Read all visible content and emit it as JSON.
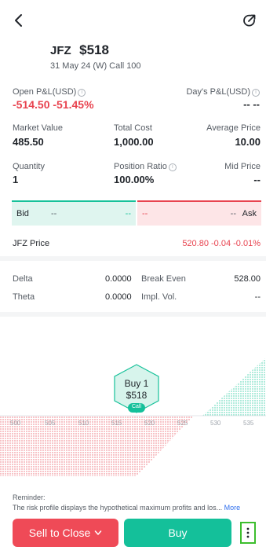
{
  "header": {
    "symbol": "JFZ",
    "price": "$518",
    "contract": "31 May 24 (W) Call 100"
  },
  "pl": {
    "open_label": "Open P&L(USD)",
    "open_value": "-514.50 -51.45%",
    "day_label": "Day's P&L(USD)",
    "day_value": "-- --"
  },
  "stats": {
    "market_value_label": "Market Value",
    "market_value": "485.50",
    "total_cost_label": "Total Cost",
    "total_cost": "1,000.00",
    "avg_price_label": "Average Price",
    "avg_price": "10.00",
    "quantity_label": "Quantity",
    "quantity": "1",
    "position_ratio_label": "Position Ratio",
    "position_ratio": "100.00%",
    "mid_price_label": "Mid Price",
    "mid_price": "--"
  },
  "quote": {
    "bid_label": "Bid",
    "bid_left": "--",
    "bid_right": "--",
    "ask_left": "--",
    "ask_right": "--",
    "ask_label": "Ask"
  },
  "underlying": {
    "symbol": "JFZ",
    "label": "Price",
    "value": "520.80 -0.04 -0.01%"
  },
  "greeks": {
    "delta_label": "Delta",
    "delta": "0.0000",
    "theta_label": "Theta",
    "theta": "0.0000",
    "break_even_label": "Break Even",
    "break_even": "528.00",
    "impl_vol_label": "Impl. Vol.",
    "impl_vol": "--"
  },
  "risk_chart": {
    "marker_line1": "Buy 1",
    "marker_line2": "$518",
    "marker_tag": "Call",
    "ticks": [
      "500",
      "505",
      "510",
      "515",
      "520",
      "525",
      "530",
      "535"
    ]
  },
  "reminder": {
    "title": "Reminder:",
    "text": "The risk profile displays the hypothetical maximum profits and los...",
    "more": "More"
  },
  "actions": {
    "sell_label": "Sell to Close",
    "buy_label": "Buy"
  },
  "colors": {
    "loss_red": "#e8434f",
    "profit_green": "#17c19a",
    "sell_button": "#ef4a57",
    "buy_button": "#14c09a"
  }
}
